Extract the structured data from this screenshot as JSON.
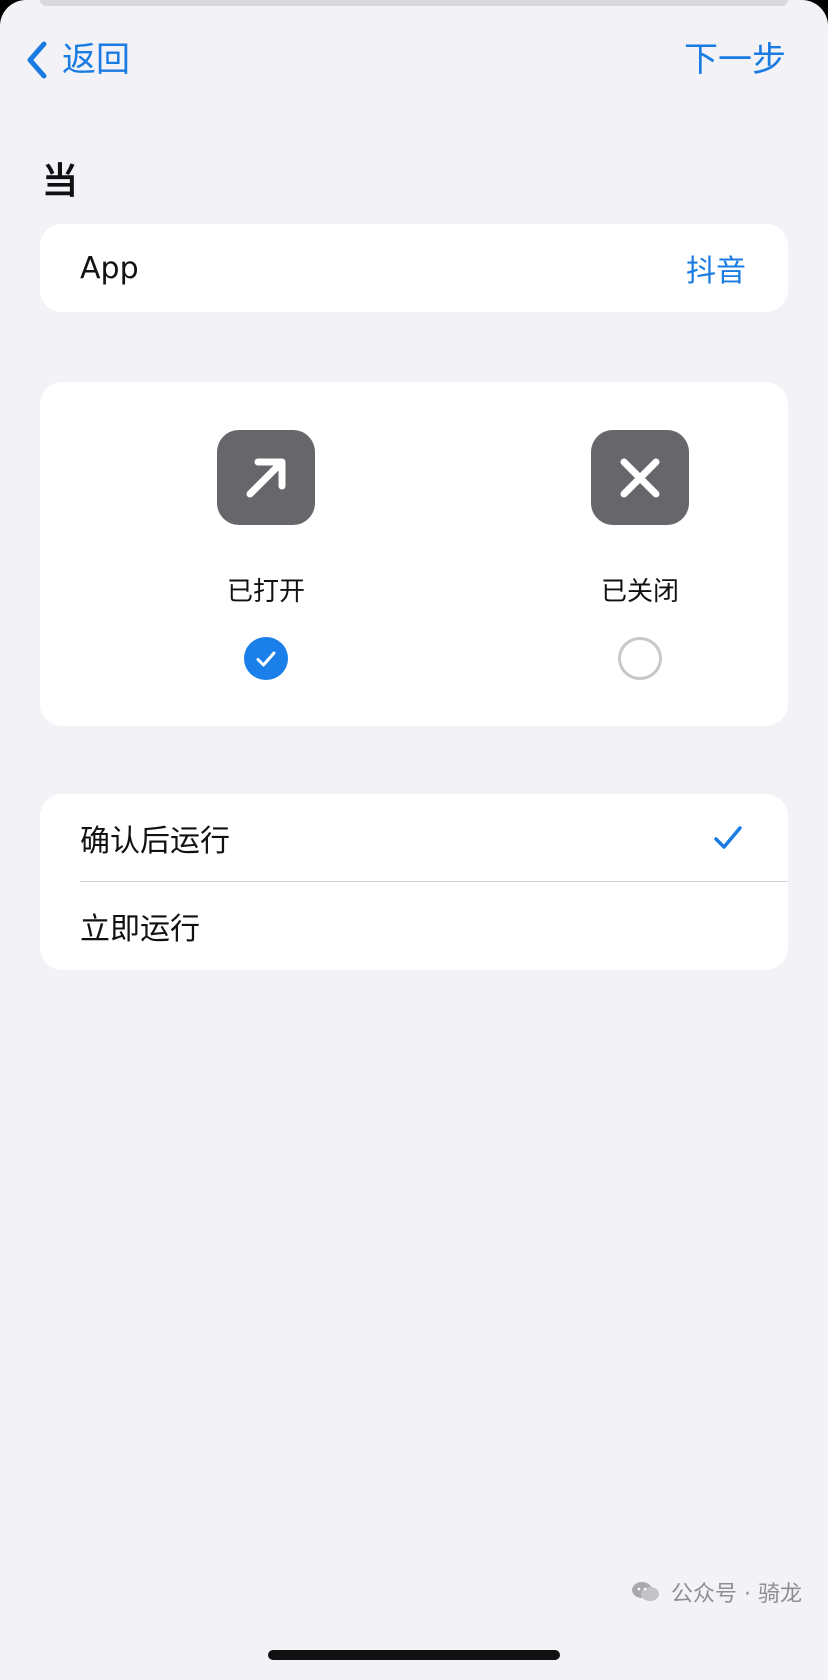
{
  "nav": {
    "back_label": "返回",
    "next_label": "下一步"
  },
  "section": {
    "title": "当"
  },
  "app_row": {
    "label": "App",
    "value": "抖音"
  },
  "state_options": {
    "opened": {
      "label": "已打开",
      "icon": "arrow-up-right-icon",
      "selected": true
    },
    "closed": {
      "label": "已关闭",
      "icon": "x-mark-icon",
      "selected": false
    }
  },
  "run_options": {
    "confirm": {
      "label": "确认后运行",
      "selected": true
    },
    "immediate": {
      "label": "立即运行",
      "selected": false
    }
  },
  "watermark": {
    "text": "公众号 · 骑龙"
  },
  "colors": {
    "accent": "#1a7be3",
    "background": "#f2f2f7",
    "card": "#ffffff",
    "icon_tile": "#66666b"
  }
}
